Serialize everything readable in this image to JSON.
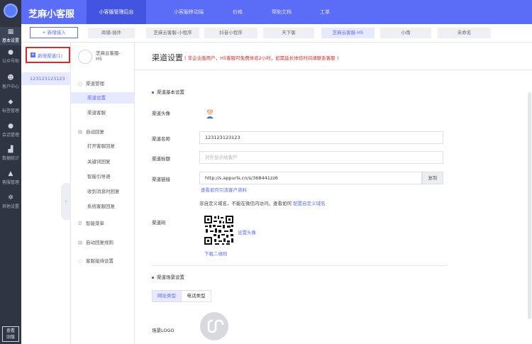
{
  "app": {
    "brand": "芝麻小客服"
  },
  "rail": {
    "items": [
      {
        "label": "基本设置",
        "icon": "grid-icon"
      },
      {
        "label": "公众号助",
        "icon": "chat-icon"
      },
      {
        "label": "客户中心",
        "icon": "users-icon"
      },
      {
        "label": "标签管理",
        "icon": "tag-icon"
      },
      {
        "label": "会话管理",
        "icon": "message-icon"
      },
      {
        "label": "数据统计",
        "icon": "chart-icon"
      },
      {
        "label": "客服管理",
        "icon": "person-icon"
      },
      {
        "label": "其他设置",
        "icon": "gear-icon"
      }
    ],
    "bottom": "查看\n旧版"
  },
  "topnav": {
    "items": [
      {
        "label": "小客服管理后台",
        "active": true
      },
      {
        "label": "小客服移动端",
        "active": false
      },
      {
        "label": "价格",
        "active": false
      },
      {
        "label": "帮助文档",
        "active": false
      },
      {
        "label": "工单",
        "active": false
      }
    ]
  },
  "tabs": {
    "new_label": "+ 新增接入",
    "items": [
      {
        "label": "商铺-插件",
        "active": false
      },
      {
        "label": "芝麻云客服-小程序",
        "active": false
      },
      {
        "label": "抖音小程序",
        "active": false
      },
      {
        "label": "天下客",
        "active": false
      },
      {
        "label": "芝麻云客服-H5",
        "active": true
      },
      {
        "label": "小雨",
        "active": false
      },
      {
        "label": "未命名",
        "active": false
      }
    ]
  },
  "channels": {
    "new_label": "新增渠道(1)",
    "items": [
      "123123123123"
    ]
  },
  "menu": {
    "site_name": "芝麻云客服-H5",
    "groups": [
      {
        "label": "渠道管理",
        "icon": "link-icon",
        "items": [
          "渠道设置",
          "渠道客服"
        ]
      },
      {
        "label": "自动回复",
        "icon": "reply-icon",
        "items": [
          "打开客服回复",
          "关键词回复",
          "智能引导语",
          "收到消息时回复",
          "系统客服回复"
        ]
      },
      {
        "label": "智能菜单",
        "icon": "menu-icon",
        "items": []
      },
      {
        "label": "自动回复规则",
        "icon": "rule-icon",
        "items": []
      },
      {
        "label": "客服接待设置",
        "icon": "headset-icon",
        "items": []
      }
    ],
    "active_item": "渠道设置"
  },
  "main": {
    "title": "渠道设置",
    "note": "( 非企业版用户，H5客服可免费体验2小时，如需延长体验时间请联系客服 )",
    "section_basic": "渠道基本设置",
    "fields": {
      "avatar_label": "渠道头像",
      "name_label": "渠道名称",
      "name_value": "123123123123",
      "title_label": "渠道标题",
      "title_placeholder": "对外显示给客户",
      "link_label": "渠道链接",
      "link_value": "http://s.appurls.cn/s/368441zz6",
      "copy_label": "复制",
      "link_help": "查看如何引流客户资料",
      "domain_note_prefix": "非自定义域名，不能在微信内访问。查看如何 ",
      "domain_note_link": "配置自定义域名",
      "qr_label": "渠道码",
      "set_avatar": "设置头像",
      "download_qr": "下载二维码"
    },
    "section_scene": "渠道场景设置",
    "scene_tabs": [
      {
        "label": "网址类型",
        "active": true
      },
      {
        "label": "电话类型",
        "active": false
      }
    ],
    "scene_logo_label": "场景LOGO"
  }
}
